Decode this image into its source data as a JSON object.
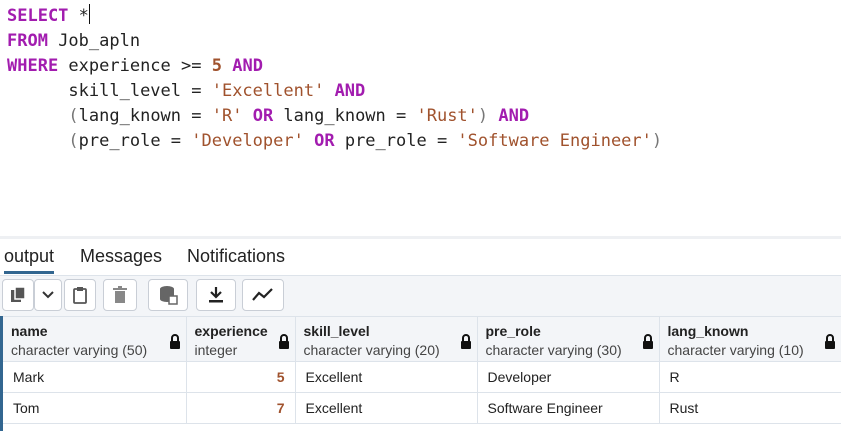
{
  "editor": {
    "l1_kw": "SELECT",
    "l1_rest": " *",
    "l2_kw": "FROM",
    "l2_rest": " Job_apln",
    "l3_kw": "WHERE",
    "l3_a": " experience >= ",
    "l3_num": "5",
    "l3_and": "AND",
    "l4_a": "skill_level = ",
    "l4_str": "'Excellent'",
    "l4_and": "AND",
    "l5_p1": "(",
    "l5_a": "lang_known = ",
    "l5_s1": "'R'",
    "l5_or": "OR",
    "l5_b": " lang_known = ",
    "l5_s2": "'Rust'",
    "l5_p2": ")",
    "l5_and": "AND",
    "l6_p1": "(",
    "l6_a": "pre_role = ",
    "l6_s1": "'Developer'",
    "l6_or": "OR",
    "l6_b": " pre_role = ",
    "l6_s2": "'Software Engineer'",
    "l6_p2": ")"
  },
  "tabs": [
    {
      "label": "output"
    },
    {
      "label": "Messages"
    },
    {
      "label": "Notifications"
    }
  ],
  "toolbar": {
    "icons": [
      "copy-icon",
      "chevron-down-icon",
      "paste-icon",
      "delete-icon",
      "save-data-icon",
      "download-icon",
      "graph-icon"
    ]
  },
  "table": {
    "columns": [
      {
        "name": "name",
        "type": "character varying (50)"
      },
      {
        "name": "experience",
        "type": "integer"
      },
      {
        "name": "skill_level",
        "type": "character varying (20)"
      },
      {
        "name": "pre_role",
        "type": "character varying (30)"
      },
      {
        "name": "lang_known",
        "type": "character varying (10)"
      }
    ],
    "rows": [
      [
        "Mark",
        "5",
        "Excellent",
        "Developer",
        "R"
      ],
      [
        "Tom",
        "7",
        "Excellent",
        "Software Engineer",
        "Rust"
      ]
    ]
  },
  "colors": {
    "keyword": "#a21caf",
    "string": "#a0522d",
    "accent": "#326690"
  }
}
